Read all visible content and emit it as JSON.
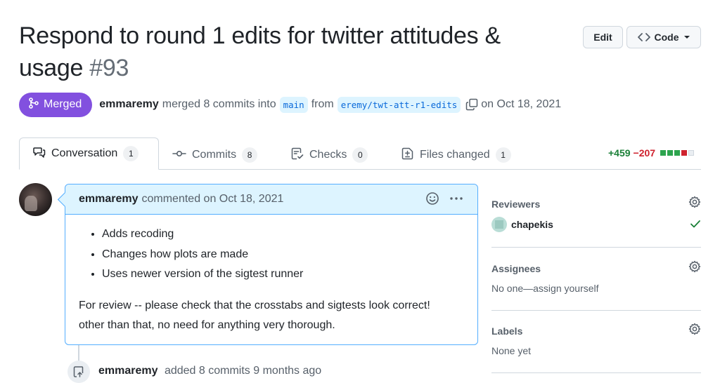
{
  "pr": {
    "title": "Respond to round 1 edits for twitter attitudes & usage",
    "number": "#93",
    "status": "Merged",
    "author": "emmaremy",
    "merge_text": "merged 8 commits into",
    "base_branch": "main",
    "from_text": "from",
    "head_branch": "eremy/twt-att-r1-edits",
    "date_text": "on Oct 18, 2021"
  },
  "header": {
    "edit_label": "Edit",
    "code_label": "Code"
  },
  "tabs": [
    {
      "label": "Conversation",
      "count": "1",
      "icon": "comment-discussion-icon"
    },
    {
      "label": "Commits",
      "count": "8",
      "icon": "git-commit-icon"
    },
    {
      "label": "Checks",
      "count": "0",
      "icon": "checklist-icon"
    },
    {
      "label": "Files changed",
      "count": "1",
      "icon": "file-diff-icon"
    }
  ],
  "diffstat": {
    "additions": "+459",
    "deletions": "−207"
  },
  "comment": {
    "author": "emmaremy",
    "meta": "commented on Oct 18, 2021",
    "bullets": [
      "Adds recoding",
      "Changes how plots are made",
      "Uses newer version of the sigtest runner"
    ],
    "paragraph_line1": "For review -- please check that the crosstabs and sigtests look correct!",
    "paragraph_line2": "other than that, no need for anything very thorough."
  },
  "event": {
    "author": "emmaremy",
    "text": "added 8 commits 9 months ago"
  },
  "sidebar": {
    "reviewers": {
      "heading": "Reviewers",
      "name": "chapekis"
    },
    "assignees": {
      "heading": "Assignees",
      "value": "No one—assign yourself"
    },
    "labels": {
      "heading": "Labels",
      "value": "None yet"
    }
  },
  "colors": {
    "merged": "#8250df",
    "link": "#0969da",
    "add": "#1a7f37",
    "del": "#cf222e"
  }
}
